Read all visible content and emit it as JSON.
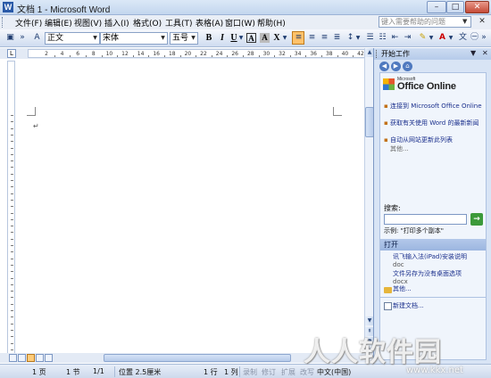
{
  "window": {
    "title": "文档 1 - Microsoft Word",
    "app_icon": "W"
  },
  "menu": {
    "items": [
      "文件(F)",
      "编辑(E)",
      "视图(V)",
      "插入(I)",
      "格式(O)",
      "工具(T)",
      "表格(A)",
      "窗口(W)",
      "帮助(H)"
    ],
    "help_placeholder": "键入需要帮助的问题"
  },
  "toolbar": {
    "style_value": "正文",
    "font_value": "宋体",
    "size_value": "五号",
    "bold": "B",
    "italic": "I",
    "underline": "U",
    "char_border": "A",
    "char_shading": "A",
    "scale": "X"
  },
  "ruler": {
    "h_numbers": [
      "2",
      "4",
      "6",
      "8",
      "10",
      "12",
      "14",
      "16",
      "18",
      "20",
      "22",
      "24",
      "26",
      "28",
      "30",
      "32",
      "34",
      "36",
      "38",
      "40",
      "42"
    ],
    "tab_selector": "L"
  },
  "task_pane": {
    "title": "开始工作",
    "brand_small": "Microsoft",
    "brand_big": "Office Online",
    "links": [
      "连接到 Microsoft Office Online",
      "获取有关使用 Word 的最新新闻",
      "自动从网站更新此列表"
    ],
    "more_link": "其他...",
    "search_label": "搜索:",
    "example_text": "示例: \"打印多个副本\"",
    "open_section": "打开",
    "recent_files": [
      {
        "name": "讯飞输入法(iPad)安装说明",
        "ext": "doc"
      },
      {
        "name": "文件另存为没有桌面选项",
        "ext": "docx"
      }
    ],
    "open_more": "其他...",
    "new_doc": "新建文档..."
  },
  "status": {
    "page": "1 页",
    "section": "1 节",
    "page_of": "1/1",
    "position": "位置 2.5厘米",
    "line": "1 行",
    "column": "1 列",
    "rec": "录制",
    "trk": "修订",
    "ext": "扩展",
    "ovr": "改写",
    "language": "中文(中国)"
  },
  "watermark": {
    "text": "人人软件园",
    "url": "www.kkx.net"
  },
  "colors": {
    "accent": "#2a5aa8",
    "panel": "#d8e4f5",
    "highlight": "#ffc26a"
  }
}
